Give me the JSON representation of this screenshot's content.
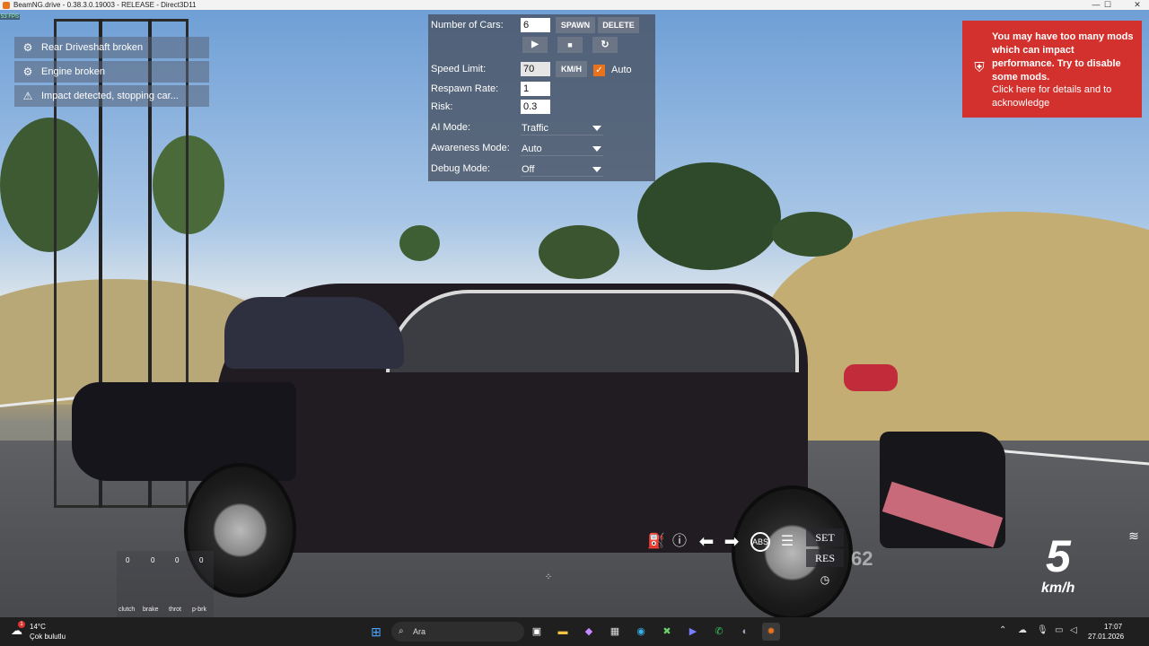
{
  "window": {
    "title": "BeamNG.drive - 0.38.3.0.19003 - RELEASE - Direct3D11",
    "minimize": "—",
    "maximize": "☐",
    "close": "✕"
  },
  "fps": "53 FPS",
  "damage_messages": [
    {
      "icon": "gear-icon",
      "text": "Rear Driveshaft broken"
    },
    {
      "icon": "gear-icon",
      "text": "Engine broken"
    },
    {
      "icon": "warning-triangle-icon",
      "text": "Impact detected, stopping car..."
    }
  ],
  "traffic": {
    "num_cars_label": "Number of Cars:",
    "num_cars_value": "6",
    "spawn_label": "SPAWN",
    "delete_label": "DELETE",
    "speed_limit_label": "Speed Limit:",
    "speed_limit_value": "70",
    "unit_label": "KM/H",
    "auto_label": "Auto",
    "auto_checked": true,
    "respawn_label": "Respawn Rate:",
    "respawn_value": "1",
    "risk_label": "Risk:",
    "risk_value": "0.3",
    "ai_mode_label": "AI Mode:",
    "ai_mode_value": "Traffic",
    "awareness_label": "Awareness Mode:",
    "awareness_value": "Auto",
    "debug_label": "Debug Mode:",
    "debug_value": "Off"
  },
  "mods_warning": {
    "title": "You may have too many mods which can impact performance. Try to disable some mods.",
    "subtitle": "Click here for details and to acknowledge"
  },
  "hud": {
    "cruise_set": "SET",
    "cruise_res": "RES",
    "cruise_speed": "62",
    "speed": "5",
    "speed_unit": "km/h",
    "pedals": [
      {
        "label": "clutch",
        "value": "0"
      },
      {
        "label": "brake",
        "value": "0"
      },
      {
        "label": "throt",
        "value": "0"
      },
      {
        "label": "p-brk",
        "value": "0"
      }
    ]
  },
  "taskbar": {
    "weather_temp": "14°C",
    "weather_desc": "Çok bulutlu",
    "weather_badge": "1",
    "search_placeholder": "Ara",
    "clock_time": "17:07",
    "clock_date": "27.01.2026"
  },
  "colors": {
    "accent": "#e9731d",
    "warning_red": "#d3312d",
    "panel_bg": "#46505f"
  }
}
